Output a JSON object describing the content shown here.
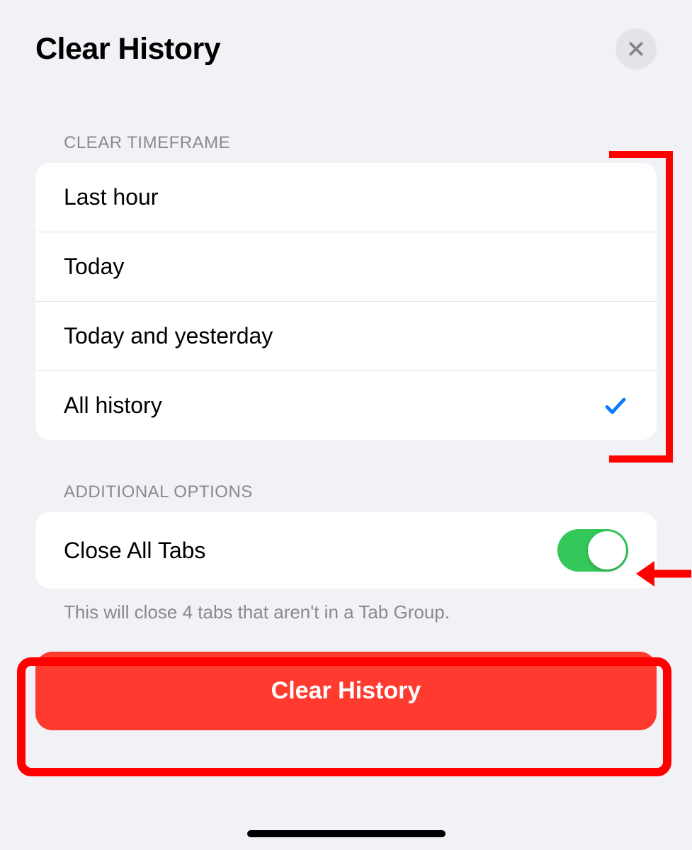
{
  "header": {
    "title": "Clear History"
  },
  "sections": {
    "timeframe": {
      "header": "CLEAR TIMEFRAME",
      "options": [
        {
          "label": "Last hour",
          "selected": false
        },
        {
          "label": "Today",
          "selected": false
        },
        {
          "label": "Today and yesterday",
          "selected": false
        },
        {
          "label": "All history",
          "selected": true
        }
      ]
    },
    "additional": {
      "header": "ADDITIONAL OPTIONS",
      "close_tabs_label": "Close All Tabs",
      "close_tabs_enabled": true,
      "footer": "This will close 4 tabs that aren't in a Tab Group."
    }
  },
  "action": {
    "label": "Clear History"
  },
  "colors": {
    "accent_green": "#34c759",
    "destructive_red": "#ff3b30",
    "annotation_red": "#ff0000",
    "check_blue": "#0a7aff"
  }
}
